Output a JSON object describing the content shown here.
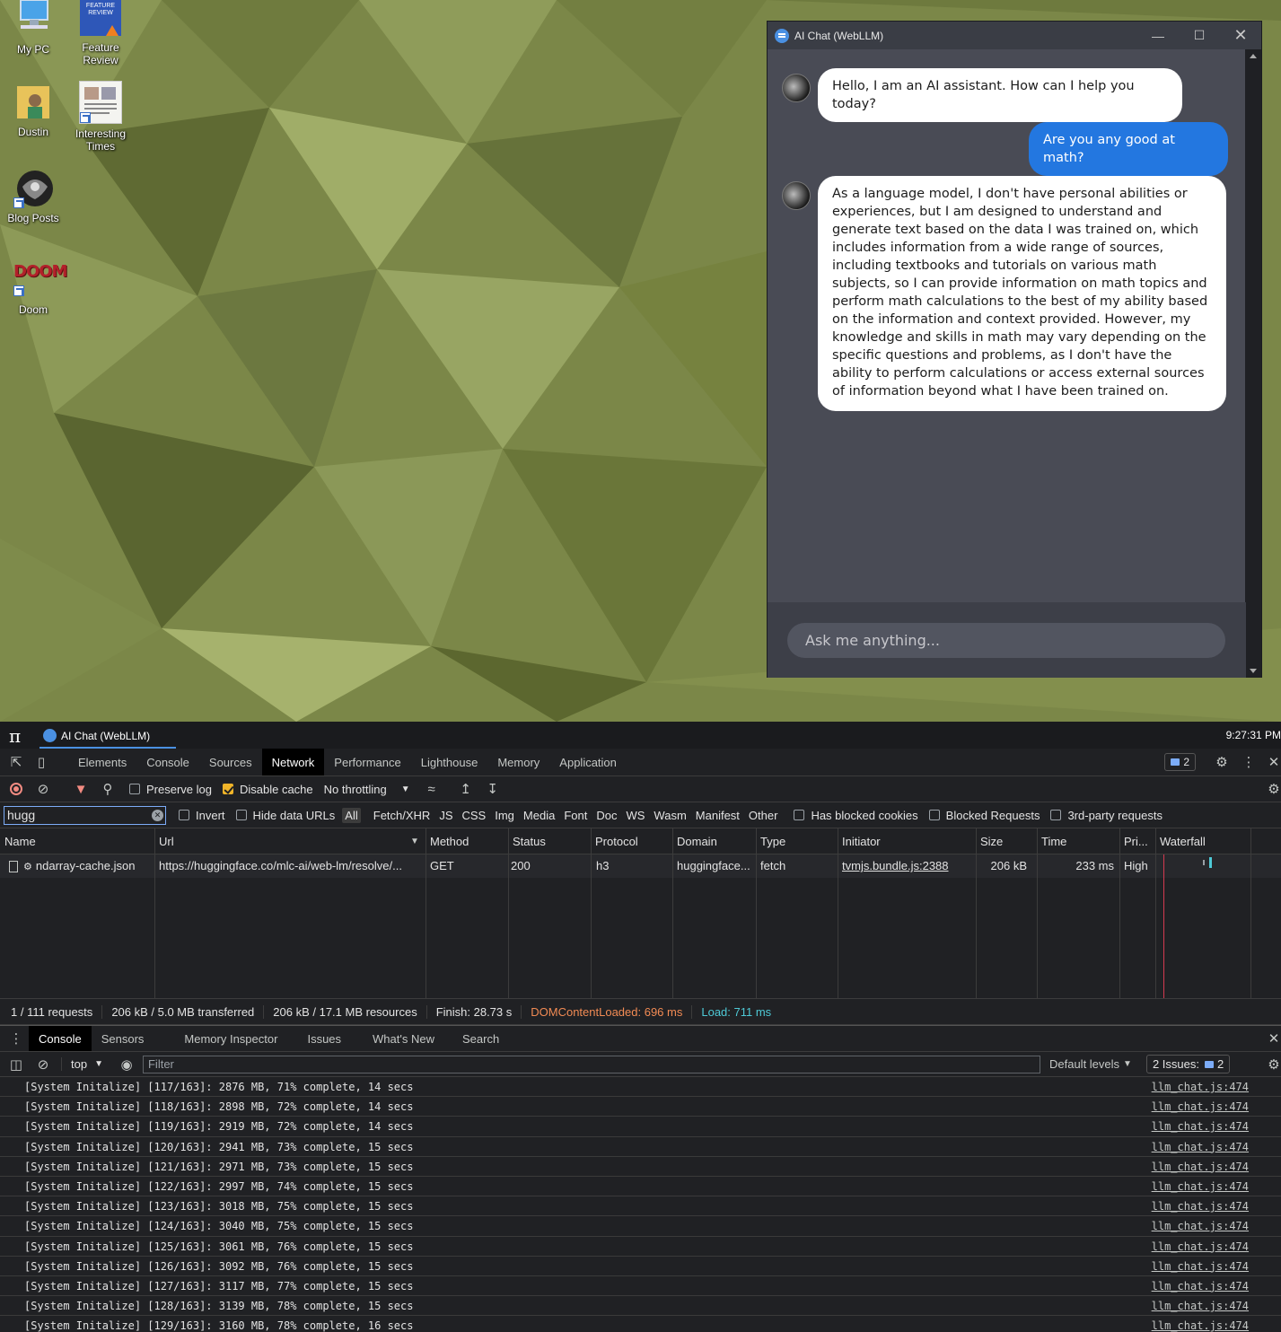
{
  "desktop": {
    "icons": [
      {
        "label": "My PC"
      },
      {
        "label": "Feature Review",
        "thumb_text": "FEATURE REVIEW"
      },
      {
        "label": "Dustin"
      },
      {
        "label": "Interesting Times"
      },
      {
        "label": "Blog Posts"
      },
      {
        "label": "Doom",
        "logo_text": "DOOM"
      }
    ]
  },
  "chat_window": {
    "title": "AI Chat (WebLLM)",
    "messages": [
      {
        "role": "bot",
        "text": "Hello, I am an AI assistant. How can I help you today?"
      },
      {
        "role": "user",
        "text": "Are you any good at math?"
      },
      {
        "role": "bot",
        "text": "As a language model, I don't have personal abilities or experiences, but I am designed to understand and generate text based on the data I was trained on, which includes information from a wide range of sources, including textbooks and tutorials on various math subjects, so I can provide information on math topics and perform math calculations to the best of my ability based on the information and context provided. However, my knowledge and skills in math may vary depending on the specific questions and problems, as I don't have the ability to perform calculations or access external sources of information beyond what I have been trained on."
      }
    ],
    "input_placeholder": "Ask me anything..."
  },
  "taskbar": {
    "start_glyph": "π",
    "task_label": "AI Chat (WebLLM)",
    "clock": "9:27:31 PM"
  },
  "devtools": {
    "tabs": [
      "Elements",
      "Console",
      "Sources",
      "Network",
      "Performance",
      "Lighthouse",
      "Memory",
      "Application"
    ],
    "active_tab": "Network",
    "issues_count": "2",
    "network_toolbar": {
      "preserve_log": "Preserve log",
      "disable_cache": "Disable cache",
      "throttling": "No throttling"
    },
    "filter": {
      "value": "hugg",
      "invert": "Invert",
      "hide_data_urls": "Hide data URLs",
      "types": [
        "All",
        "Fetch/XHR",
        "JS",
        "CSS",
        "Img",
        "Media",
        "Font",
        "Doc",
        "WS",
        "Wasm",
        "Manifest",
        "Other"
      ],
      "has_blocked_cookies": "Has blocked cookies",
      "blocked_requests": "Blocked Requests",
      "third_party": "3rd-party requests"
    },
    "table": {
      "headers": [
        "Name",
        "Url",
        "Method",
        "Status",
        "Protocol",
        "Domain",
        "Type",
        "Initiator",
        "Size",
        "Time",
        "Pri...",
        "Waterfall"
      ],
      "row": {
        "name": "ndarray-cache.json",
        "url": "https://huggingface.co/mlc-ai/web-lm/resolve/...",
        "method": "GET",
        "status": "200",
        "protocol": "h3",
        "domain": "huggingface...",
        "type": "fetch",
        "initiator": "tvmjs.bundle.js:2388",
        "size": "206 kB",
        "time": "233 ms",
        "priority": "High"
      }
    },
    "summary": {
      "requests": "1 / 111 requests",
      "transferred": "206 kB / 5.0 MB transferred",
      "resources": "206 kB / 17.1 MB resources",
      "finish": "Finish: 28.73 s",
      "dom_content_loaded": "DOMContentLoaded: 696 ms",
      "load": "Load: 711 ms",
      "dcl_color": "#f28b54",
      "load_color": "#4ec9d6"
    },
    "drawer_tabs": [
      "Console",
      "Sensors",
      "Memory Inspector",
      "Issues",
      "What's New",
      "Search"
    ],
    "console_toolbar": {
      "context": "top",
      "filter_placeholder": "Filter",
      "levels": "Default levels",
      "issues": "2 Issues:",
      "issues_count": "2"
    },
    "console_lines": [
      {
        "msg": "[System Initalize] [117/163]: 2876 MB, 71% complete, 14 secs",
        "src": "llm_chat.js:474"
      },
      {
        "msg": "[System Initalize] [118/163]: 2898 MB, 72% complete, 14 secs",
        "src": "llm_chat.js:474"
      },
      {
        "msg": "[System Initalize] [119/163]: 2919 MB, 72% complete, 14 secs",
        "src": "llm_chat.js:474"
      },
      {
        "msg": "[System Initalize] [120/163]: 2941 MB, 73% complete, 15 secs",
        "src": "llm_chat.js:474"
      },
      {
        "msg": "[System Initalize] [121/163]: 2971 MB, 73% complete, 15 secs",
        "src": "llm_chat.js:474"
      },
      {
        "msg": "[System Initalize] [122/163]: 2997 MB, 74% complete, 15 secs",
        "src": "llm_chat.js:474"
      },
      {
        "msg": "[System Initalize] [123/163]: 3018 MB, 75% complete, 15 secs",
        "src": "llm_chat.js:474"
      },
      {
        "msg": "[System Initalize] [124/163]: 3040 MB, 75% complete, 15 secs",
        "src": "llm_chat.js:474"
      },
      {
        "msg": "[System Initalize] [125/163]: 3061 MB, 76% complete, 15 secs",
        "src": "llm_chat.js:474"
      },
      {
        "msg": "[System Initalize] [126/163]: 3092 MB, 76% complete, 15 secs",
        "src": "llm_chat.js:474"
      },
      {
        "msg": "[System Initalize] [127/163]: 3117 MB, 77% complete, 15 secs",
        "src": "llm_chat.js:474"
      },
      {
        "msg": "[System Initalize] [128/163]: 3139 MB, 78% complete, 15 secs",
        "src": "llm_chat.js:474"
      },
      {
        "msg": "[System Initalize] [129/163]: 3160 MB, 78% complete, 16 secs",
        "src": "llm_chat.js:474"
      }
    ]
  }
}
